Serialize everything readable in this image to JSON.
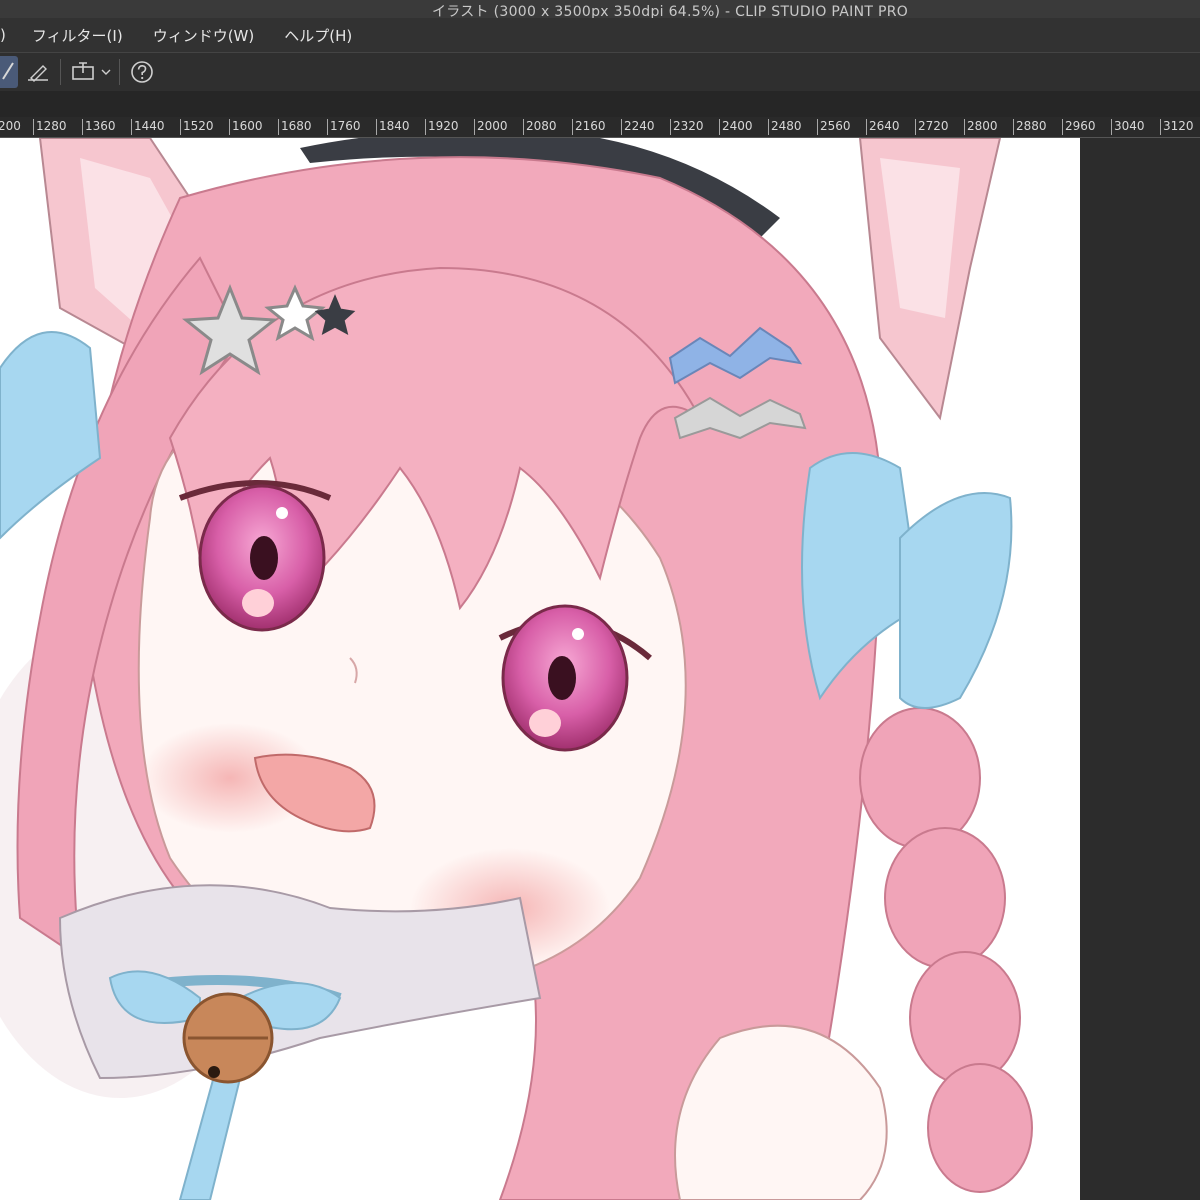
{
  "window": {
    "title": "イラスト (3000 x 3500px 350dpi 64.5%)  - CLIP STUDIO PAINT PRO"
  },
  "menu": {
    "items": [
      {
        "label": ")"
      },
      {
        "label": "フィルター(I)"
      },
      {
        "label": "ウィンドウ(W)"
      },
      {
        "label": "ヘルプ(H)"
      }
    ]
  },
  "toolbar": {
    "tools": [
      {
        "icon": "pen-icon"
      },
      {
        "icon": "ruler-edit-icon"
      },
      {
        "icon": "canvas-fit-icon"
      },
      {
        "icon": "chevron-down-icon"
      },
      {
        "icon": "help-icon"
      }
    ]
  },
  "ruler": {
    "labels": [
      "200",
      "1280",
      "1360",
      "1440",
      "1520",
      "1600",
      "1680",
      "1760",
      "1840",
      "1920",
      "2000",
      "2080",
      "2160",
      "2240",
      "2320",
      "2400",
      "2480",
      "2560",
      "2640",
      "2720",
      "2800",
      "2880",
      "2960",
      "3040",
      "3120"
    ]
  },
  "colors": {
    "accent": "#4a5a78",
    "hair": "#f0a4b8",
    "ribbon": "#9fd2ee",
    "eye": "#c8488c"
  }
}
